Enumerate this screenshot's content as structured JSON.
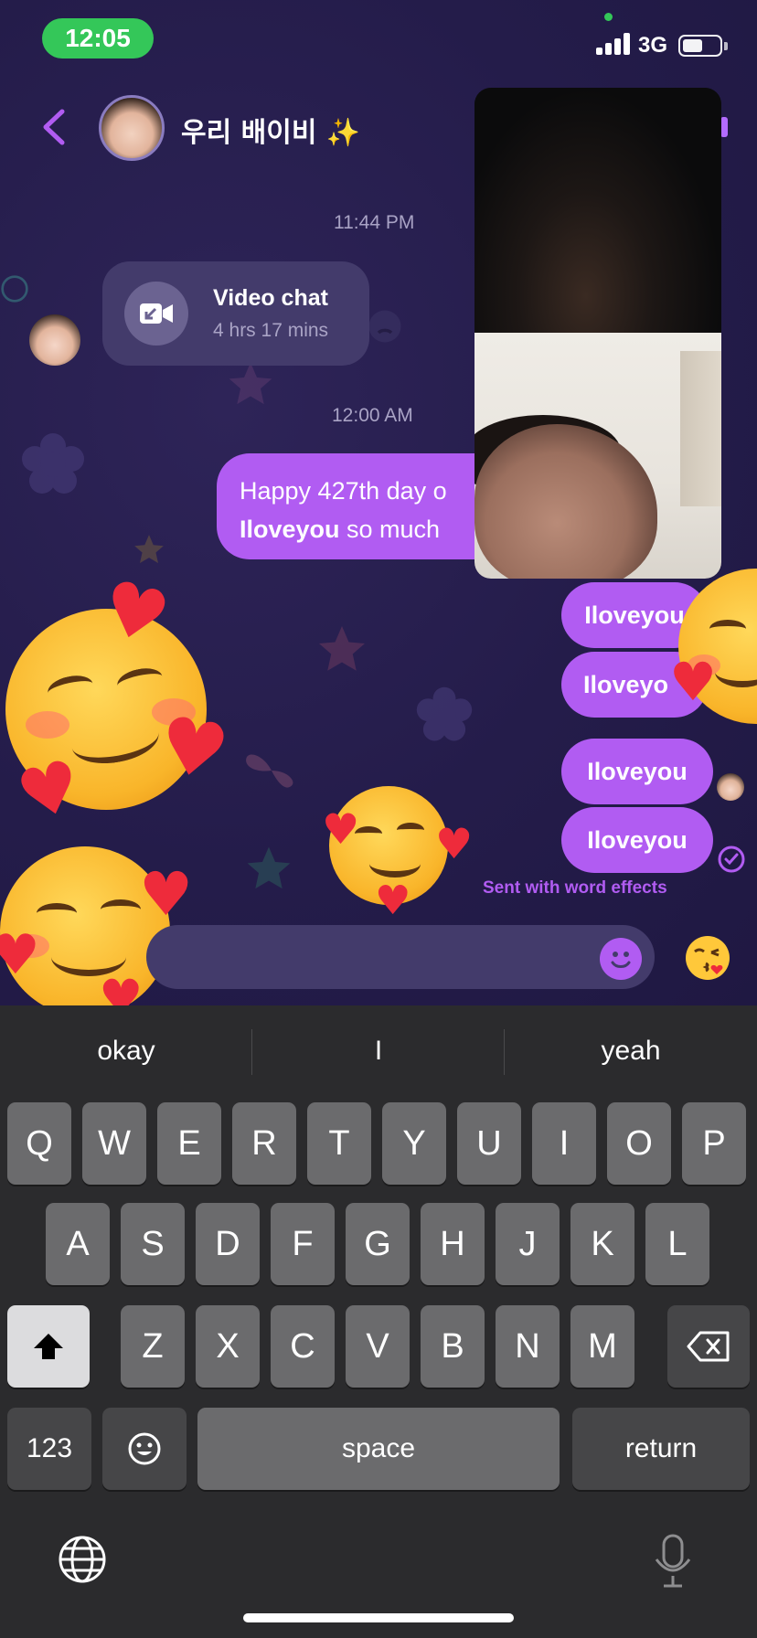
{
  "status_bar": {
    "time": "12:05",
    "network": "3G",
    "battery_level": 0.55,
    "signal_bars": 4
  },
  "header": {
    "title": "우리 배이비 ✨",
    "back_icon": "chevron-left-icon",
    "accent_color": "#b15cf2"
  },
  "messages": {
    "timestamp_1": "11:44 PM",
    "video_call": {
      "title": "Video chat",
      "duration": "4 hrs 17 mins",
      "icon": "video-camera-incoming-icon"
    },
    "timestamp_2": "12:00 AM",
    "long_message": {
      "line1": "Happy 427th day o",
      "line2_bold": "Iloveyou",
      "line2_rest": " so much "
    },
    "pills": [
      "Iloveyou",
      "Iloveyo",
      "Iloveyou",
      "Iloveyou"
    ],
    "effect_note": "Sent with word effects"
  },
  "composer": {
    "emoji_button_icon": "smile-icon",
    "quick_reaction_emoji": "😘"
  },
  "keyboard": {
    "suggestions": [
      "okay",
      "I",
      "yeah"
    ],
    "row1": [
      "Q",
      "W",
      "E",
      "R",
      "T",
      "Y",
      "U",
      "I",
      "O",
      "P"
    ],
    "row2": [
      "A",
      "S",
      "D",
      "F",
      "G",
      "H",
      "J",
      "K",
      "L"
    ],
    "row3": [
      "Z",
      "X",
      "C",
      "V",
      "B",
      "N",
      "M"
    ],
    "numbers_label": "123",
    "space_label": "space",
    "return_label": "return",
    "globe_icon": "globe-icon",
    "mic_icon": "microphone-icon",
    "shift_icon": "shift-icon",
    "delete_icon": "backspace-icon",
    "emoji_icon": "emoji-icon"
  },
  "colors": {
    "chat_bg": "#241c4a",
    "bubble_out": "#b15cf2",
    "card_bg": "#433b6b",
    "keyboard_bg": "#2b2b2d",
    "key_bg": "#6b6b6d"
  }
}
